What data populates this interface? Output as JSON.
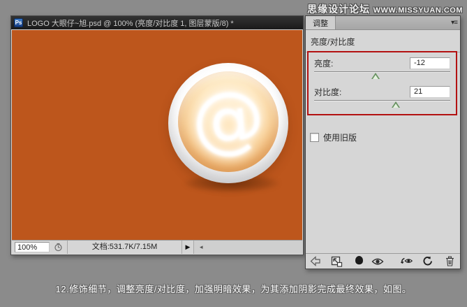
{
  "watermark": {
    "forum_name": "思缘设计论坛",
    "site_url": "WWW.MISSYUAN.COM"
  },
  "document_window": {
    "app_icon_label": "Ps",
    "title": "LOGO 大眼仔~旭.psd @ 100% (亮度/对比度 1, 图层蒙版/8) *",
    "canvas": {
      "at_symbol": "@",
      "background_color": "#bd561c"
    },
    "status_bar": {
      "zoom_value": "100%",
      "doc_info": "文档:531.7K/7.15M",
      "expand_arrow": "▶",
      "scroll_arrow": "◂"
    }
  },
  "adjustments_panel": {
    "tab_label": "调整",
    "panel_menu_glyph": "▾≡",
    "panel_title": "亮度/对比度",
    "brightness": {
      "label": "亮度:",
      "value": "-12",
      "slider_percent": 45
    },
    "contrast": {
      "label": "对比度:",
      "value": "21",
      "slider_percent": 60
    },
    "legacy_label": "使用旧版",
    "highlight_color": "#b31111",
    "footer_icon_names": [
      "back-arrow-icon",
      "expanded-view-icon",
      "clip-to-layer-icon",
      "visibility-eye-icon",
      "previous-state-icon",
      "reset-icon",
      "trash-icon"
    ]
  },
  "caption": "12.修饰细节，调整亮度/对比度，加强明暗效果，为其添加阴影完成最终效果，如图。",
  "colors": {
    "background_gray": "#8b8b8b",
    "panel_gray": "#d6d6d6",
    "canvas_orange": "#bd561c",
    "highlight_red": "#b31111"
  }
}
